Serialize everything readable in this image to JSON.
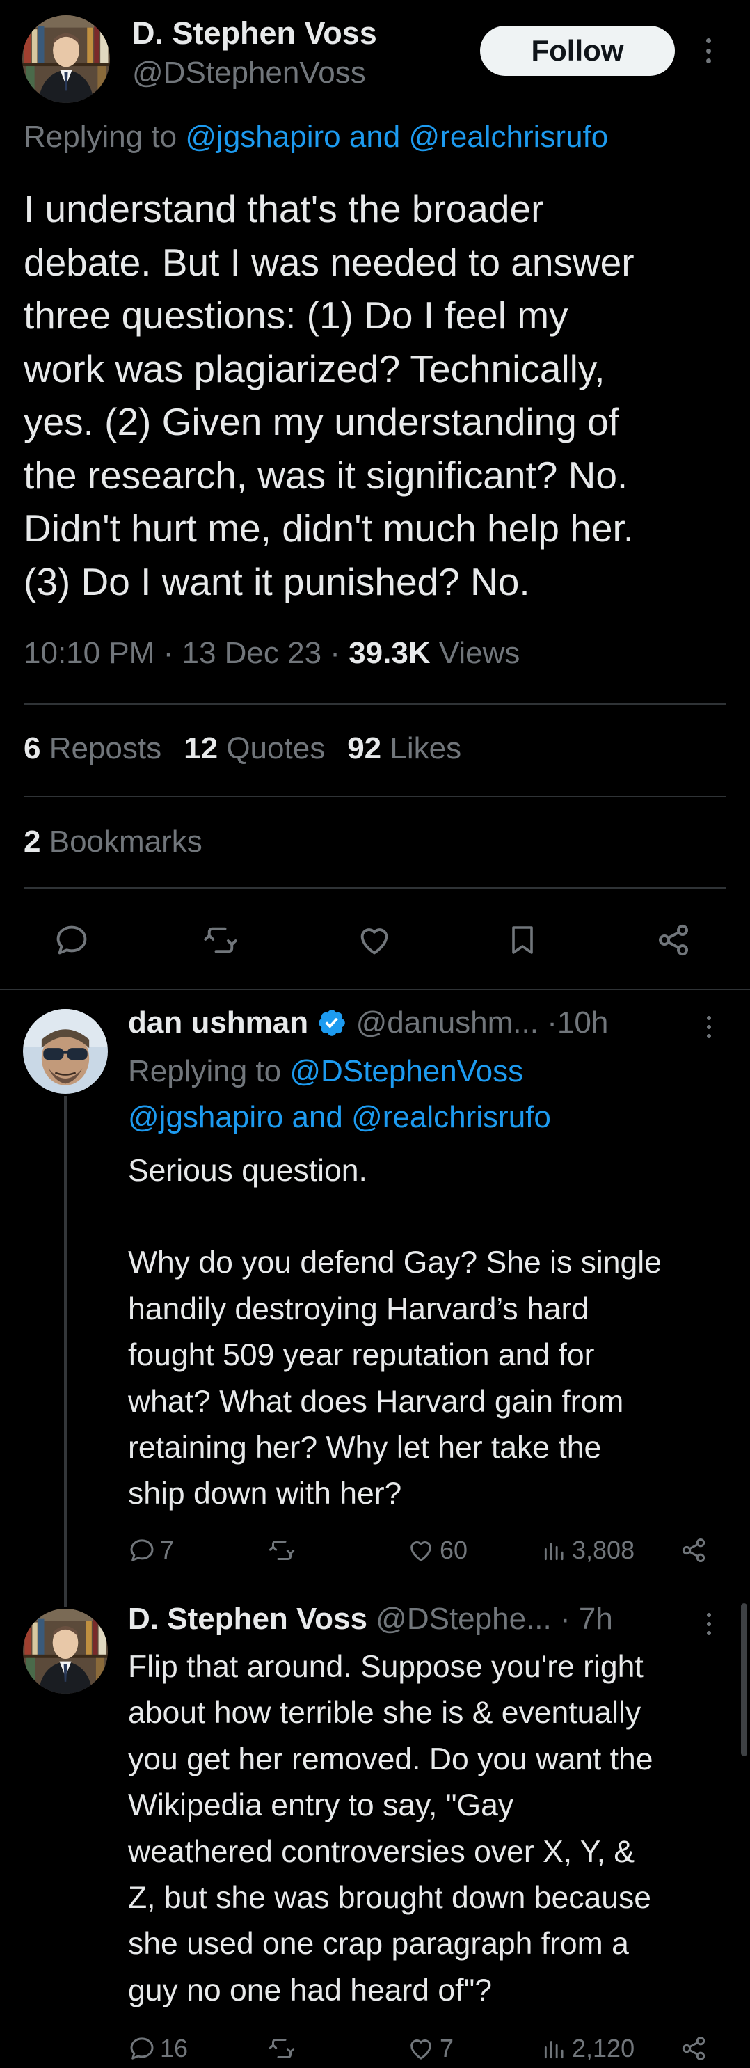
{
  "colors": {
    "background": "#000000",
    "text": "#e7e9ea",
    "muted": "#71767b",
    "accent": "#1d9bf0",
    "divider": "#2f3336"
  },
  "main_tweet": {
    "author_name": "D. Stephen Voss",
    "author_handle": "@DStephenVoss",
    "follow_label": "Follow",
    "replying_prefix": "Replying to",
    "replying_to_1": "@jgshapiro",
    "replying_and": "and",
    "replying_to_2": "@realchrisrufo",
    "text_lines": [
      "I understand that's the broader",
      "debate. But I was needed to answer",
      "three questions: (1) Do I feel my",
      "work was plagiarized? Technically,",
      "yes. (2) Given my understanding of",
      "the research, was it significant? No.",
      "Didn't hurt me, didn't much help her.",
      "(3) Do I want it punished? No."
    ],
    "time": "10:10 PM",
    "date": "13 Dec 23",
    "views_count": "39.3K",
    "views_label": "Views",
    "reposts_count": "6",
    "reposts_label": "Reposts",
    "quotes_count": "12",
    "quotes_label": "Quotes",
    "likes_count": "92",
    "likes_label": "Likes",
    "bookmarks_count": "2",
    "bookmarks_label": "Bookmarks",
    "actions": [
      "reply-icon",
      "repost-icon",
      "like-icon",
      "bookmark-icon",
      "share-icon"
    ]
  },
  "replies": [
    {
      "author_name": "dan ushman",
      "verified": true,
      "author_handle": "@danushm...",
      "time_sep": "·",
      "time": "10h",
      "replying_prefix": "Replying to",
      "replying_to_1": "@DStephenVoss",
      "replying_to_2": "@jgshapiro",
      "replying_and": "and",
      "replying_to_3": "@realchrisrufo",
      "text_lines": [
        "Serious question.",
        "",
        "Why do you defend Gay? She is single",
        "handily destroying Harvard’s hard",
        "fought 509 year reputation and for",
        "what? What does Harvard gain from",
        "retaining her? Why let her take the",
        "ship down with her?"
      ],
      "replies_count": "7",
      "reposts_count": "",
      "likes_count": "60",
      "views_count": "3,808"
    },
    {
      "author_name": "D. Stephen Voss",
      "author_handle": "@DStephe...",
      "time_sep": "·",
      "time": "7h",
      "text_lines": [
        "Flip that around. Suppose you're right",
        "about how terrible she is & eventually",
        "you get her removed. Do you want the",
        "Wikipedia entry to say, \"Gay",
        "weathered controversies over X, Y, &",
        "Z, but she was brought down because",
        "she used one crap paragraph from a",
        "guy no one had heard of\"?"
      ],
      "replies_count": "16",
      "reposts_count": "",
      "likes_count": "7",
      "views_count": "2,120"
    }
  ]
}
